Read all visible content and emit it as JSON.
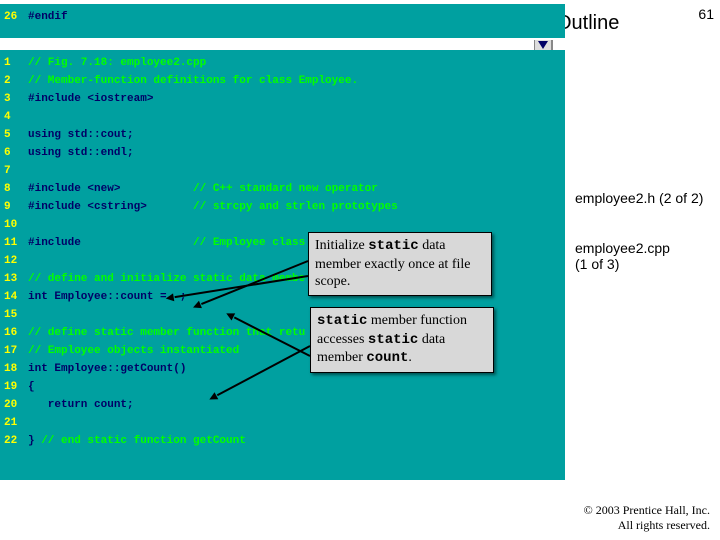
{
  "pageNumber": "61",
  "outline": "Outline",
  "sidebar": {
    "file1": "employee2.h (2 of 2)",
    "file2": "employee2.cpp",
    "file2part": "(1 of 3)"
  },
  "topBlock": {
    "lineNo": "26",
    "text": "#endif"
  },
  "code": [
    {
      "n": "1",
      "seg": [
        {
          "c": "green",
          "t": "// Fig. 7.18: employee2.cpp"
        }
      ]
    },
    {
      "n": "2",
      "seg": [
        {
          "c": "green",
          "t": "// Member-function definitions for class Employee."
        }
      ]
    },
    {
      "n": "3",
      "seg": [
        {
          "c": "navy",
          "t": "#include "
        },
        {
          "c": "navy",
          "t": "<iostream>"
        }
      ]
    },
    {
      "n": "4",
      "seg": []
    },
    {
      "n": "5",
      "seg": [
        {
          "c": "navy",
          "t": "using std::cout;"
        }
      ]
    },
    {
      "n": "6",
      "seg": [
        {
          "c": "navy",
          "t": "using std::endl;"
        }
      ]
    },
    {
      "n": "7",
      "seg": []
    },
    {
      "n": "8",
      "seg": [
        {
          "c": "navy",
          "t": "#include <new>           "
        },
        {
          "c": "green",
          "t": "// C++ standard new operator"
        }
      ]
    },
    {
      "n": "9",
      "seg": [
        {
          "c": "navy",
          "t": "#include <cstring>       "
        },
        {
          "c": "green",
          "t": "// strcpy and strlen prototypes"
        }
      ]
    },
    {
      "n": "10",
      "seg": []
    },
    {
      "n": "11",
      "seg": [
        {
          "c": "navy",
          "t": "#include                 "
        },
        {
          "c": "green",
          "t": "// Employee class "
        }
      ]
    },
    {
      "n": "12",
      "seg": []
    },
    {
      "n": "13",
      "seg": [
        {
          "c": "green",
          "t": "// define and initialize static data membe"
        }
      ]
    },
    {
      "n": "14",
      "seg": [
        {
          "c": "navy",
          "t": "int Employee::count =  ;"
        }
      ]
    },
    {
      "n": "15",
      "seg": []
    },
    {
      "n": "16",
      "seg": [
        {
          "c": "green",
          "t": "// define static member function that retu"
        }
      ]
    },
    {
      "n": "17",
      "seg": [
        {
          "c": "green",
          "t": "// Employee objects instantiated"
        }
      ]
    },
    {
      "n": "18",
      "seg": [
        {
          "c": "navy",
          "t": "int Employee::getCount()"
        }
      ]
    },
    {
      "n": "19",
      "seg": [
        {
          "c": "navy",
          "t": "{"
        }
      ]
    },
    {
      "n": "20",
      "seg": [
        {
          "c": "navy",
          "t": "   return count;"
        }
      ]
    },
    {
      "n": "21",
      "seg": []
    },
    {
      "n": "22",
      "seg": [
        {
          "c": "navy",
          "t": "} "
        },
        {
          "c": "green",
          "t": "// end static function getCount"
        }
      ]
    }
  ],
  "callouts": {
    "c1": {
      "pre": "Initialize ",
      "mono1": "static",
      "mid": " data member exactly once at file scope."
    },
    "c2": {
      "mono1": "static",
      "t1": " member function accesses ",
      "mono2": "static",
      "t2": " data member ",
      "mono3": "count",
      "t3": "."
    }
  },
  "copyright": {
    "l1": "© 2003 Prentice Hall, Inc.",
    "l2": "All rights reserved."
  }
}
